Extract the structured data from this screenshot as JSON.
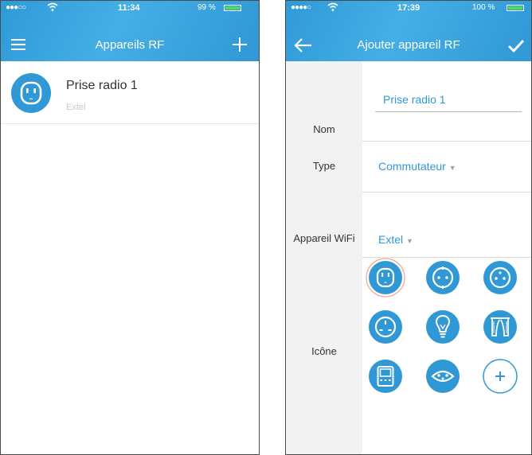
{
  "left_screen": {
    "status": {
      "signal": "●●●○○",
      "time": "11:34",
      "battery": "99 %"
    },
    "header": {
      "title": "Appareils RF",
      "menu_icon": "hamburger-icon",
      "add_icon": "plus-icon"
    },
    "devices": [
      {
        "name": "Prise radio 1",
        "subtitle": "Extel",
        "icon": "outlet-icon"
      }
    ]
  },
  "right_screen": {
    "status": {
      "signal": "●●●●○",
      "time": "17:39",
      "battery": "100 %"
    },
    "header": {
      "title": "Ajouter appareil RF",
      "back_icon": "back-arrow-icon",
      "confirm_icon": "check-icon"
    },
    "form": {
      "name_label": "Nom",
      "name_value": "Prise radio 1",
      "type_label": "Type",
      "type_value": "Commutateur",
      "wifi_label": "Appareil WiFi",
      "wifi_value": "Extel",
      "icon_label": "Icône"
    },
    "icons": [
      "us-outlet-icon",
      "eu-outlet-icon",
      "eu-outlet-round-icon",
      "uk-outlet-icon",
      "bulb-icon",
      "curtain-icon",
      "thermostat-icon",
      "ch-outlet-icon",
      "add-icon"
    ],
    "selected_icon_index": 0
  },
  "colors": {
    "accent": "#2f98d5",
    "nav": "#39a6e0",
    "battery": "#4cd964",
    "selected_ring": "#f3a48a"
  }
}
